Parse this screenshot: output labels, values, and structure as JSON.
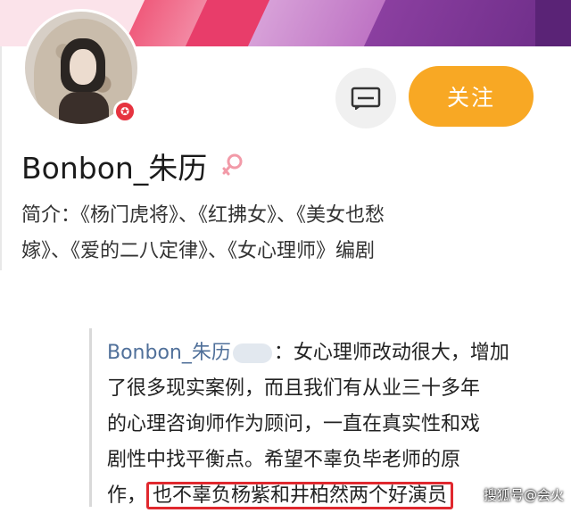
{
  "profile": {
    "username": "Bonbon_朱历",
    "bio_line1": "简介：《杨门虎将》、《红拂女》、《美女也愁",
    "bio_line2": "嫁》、《爱的二八定律》、《女心理师》编剧",
    "follow_label": "关注",
    "vip_badge": "✪",
    "gender_icon": "female-icon",
    "message_icon": "message-icon"
  },
  "comment": {
    "author": "Bonbon_朱历",
    "line1_text": "：女心理师改动很大，增加",
    "line2": "了很多现实案例，而且我们有从业三十多年",
    "line3": "的心理咨询师作为顾问，一直在真实性和戏",
    "line4": "剧性中找平衡点。希望不辜负毕老师的原",
    "line5_prefix": "作，",
    "line5_highlight": "也不辜负杨紫和井柏然两个好演员"
  },
  "watermark": "搜狐号@会火",
  "colors": {
    "follow": "#f8a824",
    "highlight_border": "#e0282e",
    "author_link": "#50709a"
  }
}
